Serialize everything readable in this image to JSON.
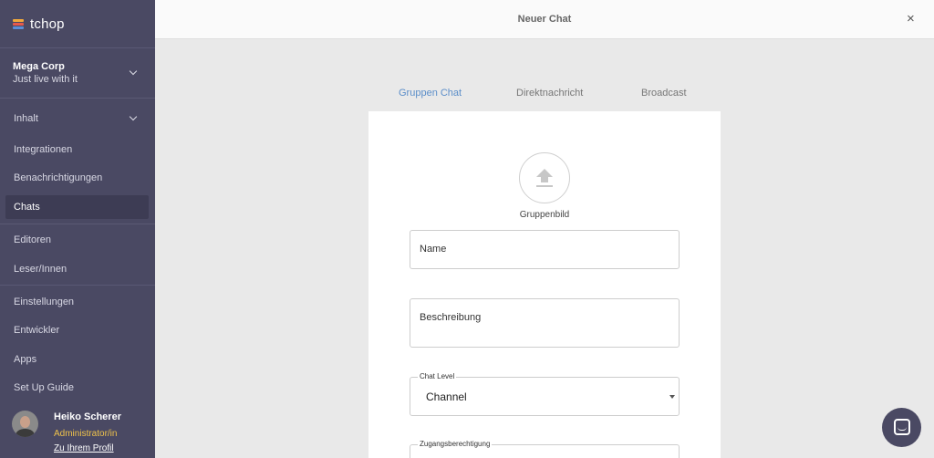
{
  "app": {
    "name": "tchop"
  },
  "organization": {
    "name": "Mega Corp",
    "tagline": "Just live with it"
  },
  "sidebar": {
    "items": [
      {
        "label": "Inhalt"
      },
      {
        "label": "Integrationen"
      },
      {
        "label": "Benachrichtigungen"
      },
      {
        "label": "Chats"
      },
      {
        "label": "Editoren"
      },
      {
        "label": "Leser/Innen"
      },
      {
        "label": "Einstellungen"
      },
      {
        "label": "Entwickler"
      },
      {
        "label": "Apps"
      },
      {
        "label": "Set Up Guide"
      }
    ]
  },
  "user": {
    "name": "Heiko Scherer",
    "role": "Administrator/in",
    "profile_link": "Zu Ihrem Profil"
  },
  "header": {
    "title": "Neuer Chat",
    "close": "×"
  },
  "tabs": [
    {
      "label": "Gruppen Chat"
    },
    {
      "label": "Direktnachricht"
    },
    {
      "label": "Broadcast"
    }
  ],
  "form": {
    "group_image_label": "Gruppenbild",
    "name_placeholder": "Name",
    "description_placeholder": "Beschreibung",
    "chat_level_label": "Chat Level",
    "chat_level_value": "Channel",
    "access_label": "Zugangsberechtigung"
  },
  "colors": {
    "sidebar": "#4a4963",
    "accent": "#5b8ec9",
    "role": "#f0c34b"
  },
  "icons": [
    "chevron-down-icon",
    "close-icon",
    "upload-icon",
    "chat-bubble-icon"
  ]
}
